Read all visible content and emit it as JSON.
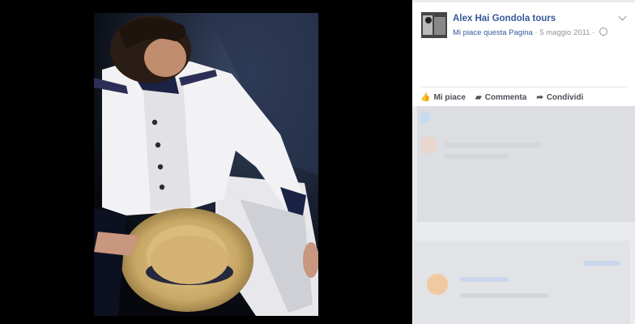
{
  "post": {
    "page_name": "Alex Hai Gondola tours",
    "like_page_link": "Mi piace questa Pagina",
    "separator": " · ",
    "date": "5 maggio 2011",
    "date_separator": " · "
  },
  "actions": {
    "like": "Mi piace",
    "comment": "Commenta",
    "share": "Condividi"
  },
  "icons": {
    "like": "thumbs-up-icon",
    "comment": "comment-icon",
    "share": "share-icon",
    "audience": "globe-icon",
    "menu": "chevron-down-icon"
  },
  "colors": {
    "link": "#365899",
    "meta": "#90949c",
    "sidebar_bg": "#e9ebee"
  }
}
